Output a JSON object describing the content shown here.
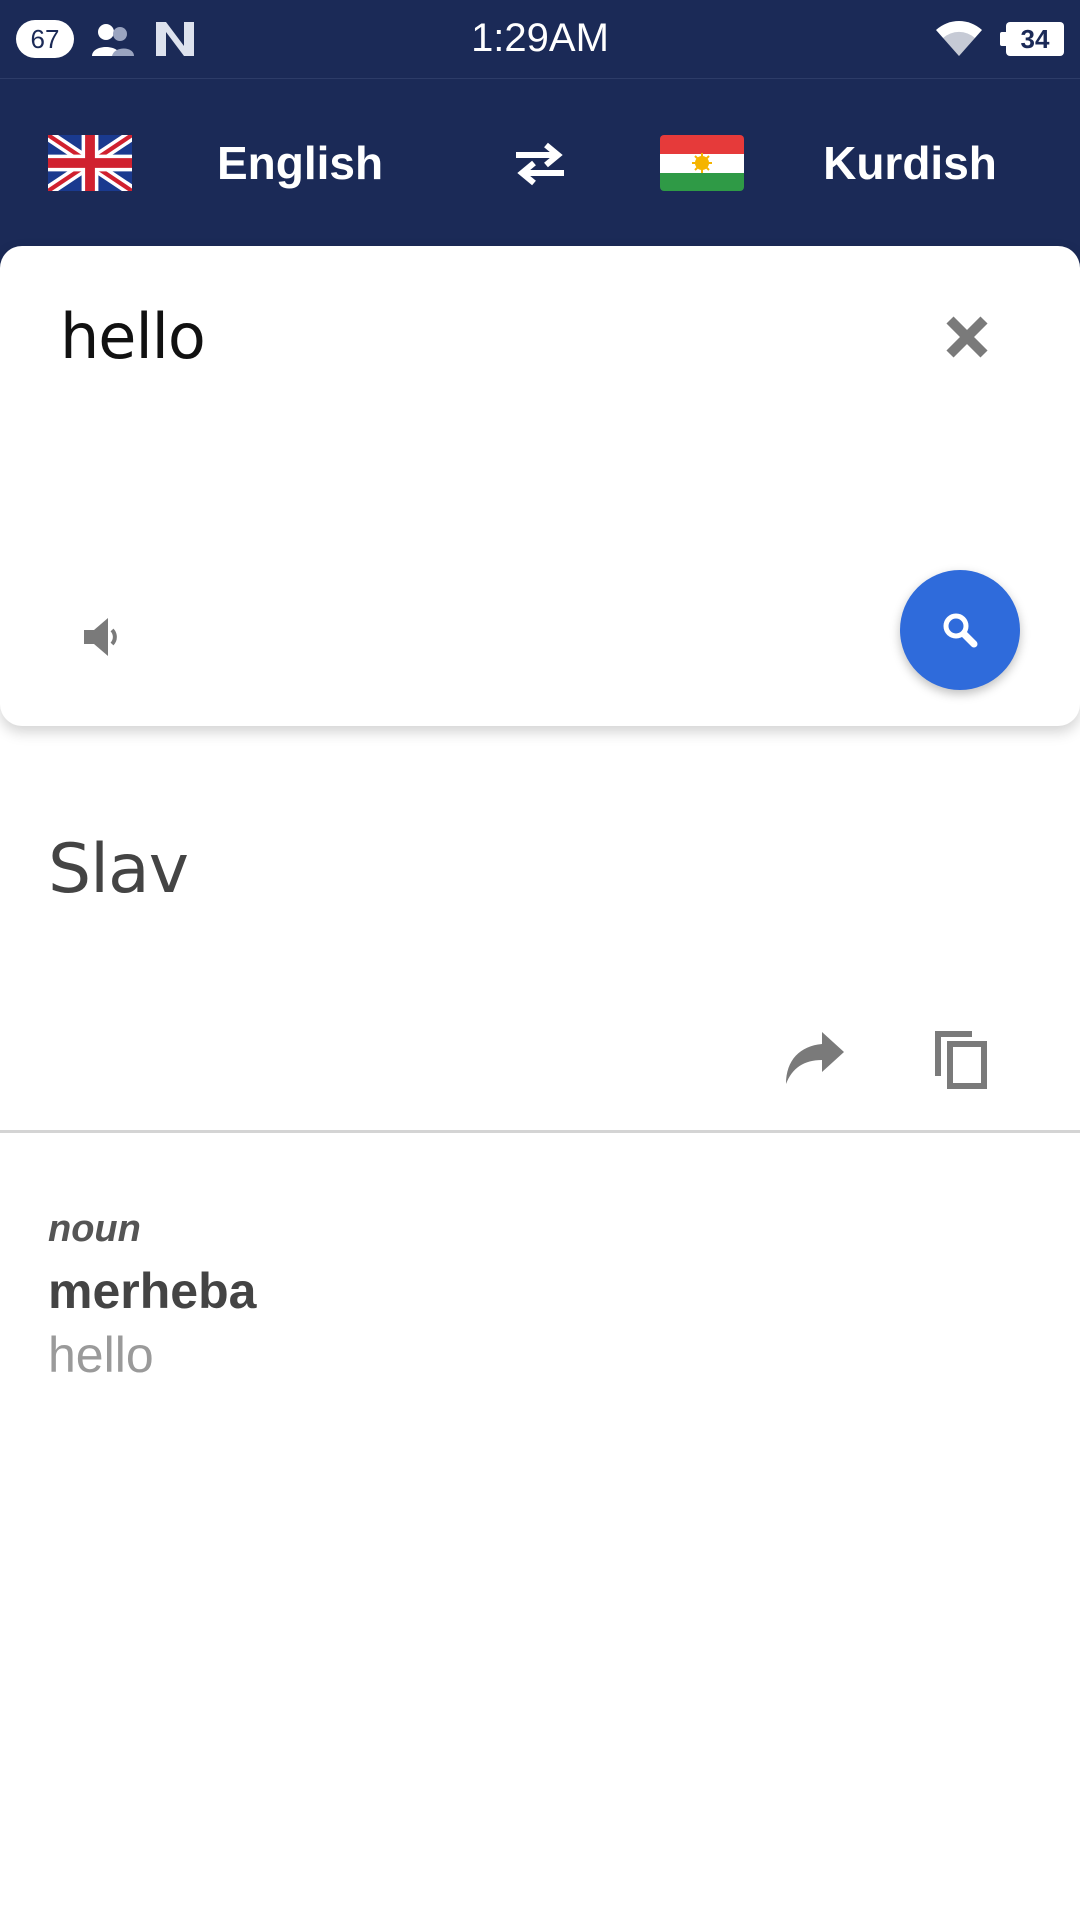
{
  "status_bar": {
    "notification_count": "67",
    "time": "1:29AM",
    "battery": "34"
  },
  "header": {
    "source_language": "English",
    "target_language": "Kurdish",
    "source_flag": "uk-flag-icon",
    "target_flag": "kurdistan-flag-icon"
  },
  "input": {
    "text": "hello"
  },
  "result": {
    "translation": "Slav"
  },
  "dictionary": {
    "part_of_speech": "noun",
    "word": "merheba",
    "gloss": "hello"
  },
  "colors": {
    "header_bg": "#1b2a57",
    "accent": "#2f6bdb",
    "icon_gray": "#7a7a7a"
  }
}
